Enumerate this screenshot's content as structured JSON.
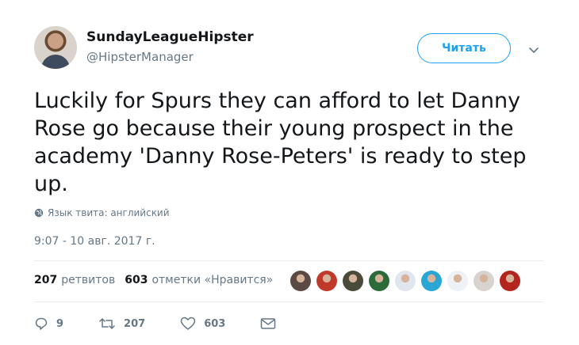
{
  "author": {
    "display_name": "SundayLeagueHipster",
    "handle": "@HipsterManager"
  },
  "follow_button": {
    "label": "Читать"
  },
  "tweet": {
    "text_lines": [
      "Luckily for Spurs they can afford to let Danny",
      "Rose go because their young prospect in the",
      "academy 'Danny Rose-Peters' is ready to step",
      "up."
    ],
    "language_label": "Язык твита: английский",
    "timestamp": "9:07 - 10 авг. 2017 г."
  },
  "stats": {
    "retweets_count": "207",
    "retweets_label": "ретвитов",
    "likes_count": "603",
    "likes_label": "отметки «Нравится»"
  },
  "likers": [
    {
      "color": "#5b4a43"
    },
    {
      "color": "#c0392b"
    },
    {
      "color": "#4a4a3a"
    },
    {
      "color": "#2d6a3a"
    },
    {
      "color": "#dfe6ee"
    },
    {
      "color": "#2aa6d6"
    },
    {
      "color": "#eef2f6"
    },
    {
      "color": "#d8d3cf"
    },
    {
      "color": "#b3261e"
    }
  ],
  "actions": {
    "reply_count": "9",
    "retweet_count": "207",
    "like_count": "603"
  },
  "colors": {
    "accent": "#1da1f2",
    "secondary_text": "#657786",
    "divider": "#e6ecf0"
  }
}
